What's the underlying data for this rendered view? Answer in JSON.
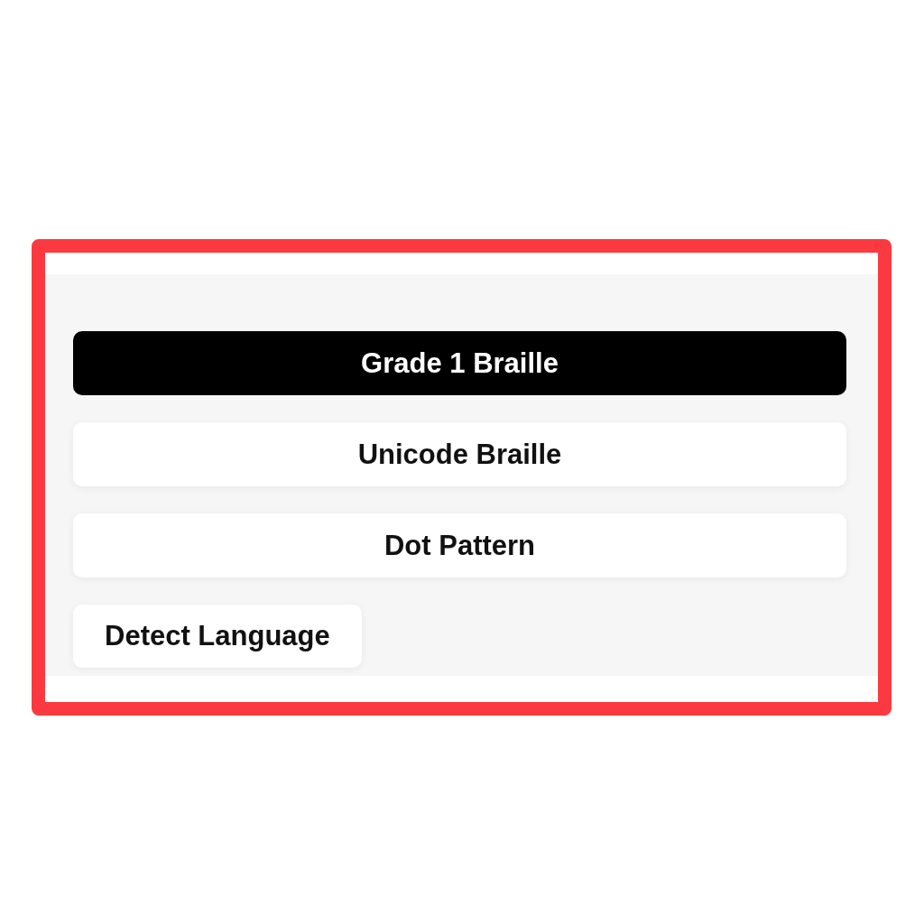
{
  "format_options": [
    {
      "label": "Grade 1 Braille",
      "selected": true
    },
    {
      "label": "Unicode Braille",
      "selected": false
    },
    {
      "label": "Dot Pattern",
      "selected": false
    }
  ],
  "detect_language_button": {
    "label": "Detect Language"
  }
}
